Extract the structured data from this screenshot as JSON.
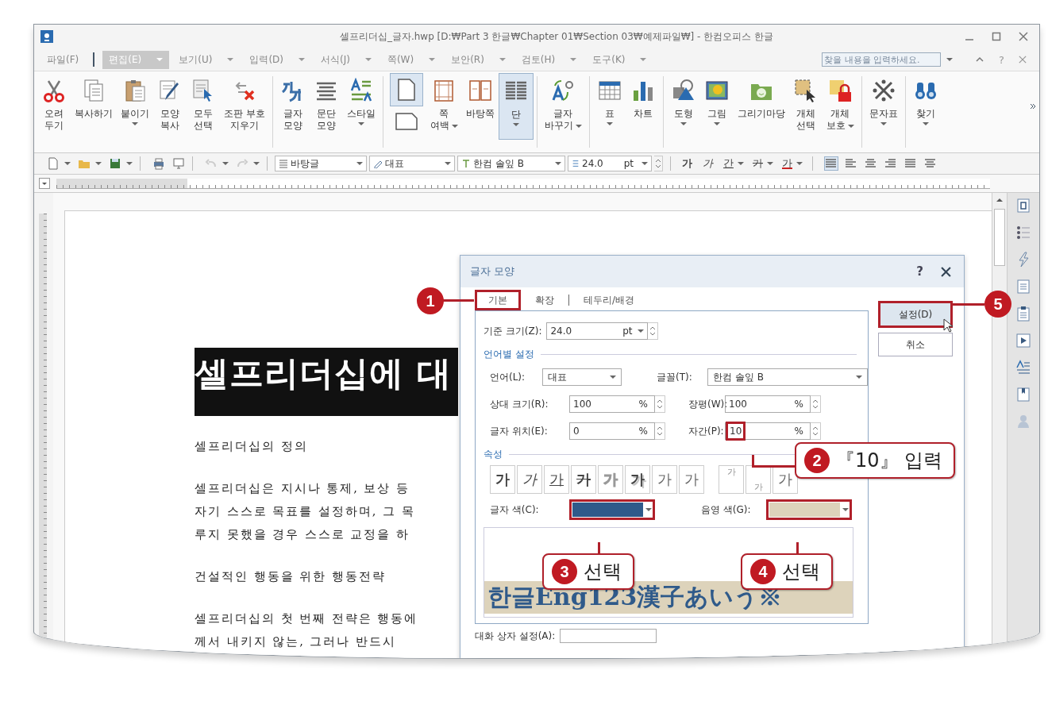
{
  "window": {
    "title": "셀프리더십_글자.hwp [D:₩Part 3 한글₩Chapter 01₩Section 03₩예제파일₩] - 한컴오피스 한글"
  },
  "menu": [
    {
      "label": "파일(F)",
      "selected": false,
      "dropdown": false
    },
    {
      "label": "편집(E)",
      "selected": true,
      "dropdown": true
    },
    {
      "label": "보기(U)",
      "selected": false,
      "dropdown": true
    },
    {
      "label": "입력(D)",
      "selected": false,
      "dropdown": true
    },
    {
      "label": "서식(J)",
      "selected": false,
      "dropdown": true
    },
    {
      "label": "쪽(W)",
      "selected": false,
      "dropdown": true
    },
    {
      "label": "보안(R)",
      "selected": false,
      "dropdown": true
    },
    {
      "label": "검토(H)",
      "selected": false,
      "dropdown": true
    },
    {
      "label": "도구(K)",
      "selected": false,
      "dropdown": true
    }
  ],
  "search": {
    "placeholder": "찾을 내용을 입력하세요."
  },
  "help": "?",
  "ribbon": [
    [
      {
        "lines": [
          "오려",
          "두기"
        ],
        "dropdown": false,
        "selected": false
      },
      {
        "lines": [
          "복사하기"
        ],
        "dropdown": false,
        "selected": false
      },
      {
        "lines": [
          "붙이기"
        ],
        "dropdown": true,
        "selected": false
      },
      {
        "lines": [
          "모양",
          "복사"
        ],
        "dropdown": false,
        "selected": false
      },
      {
        "lines": [
          "모두",
          "선택"
        ],
        "dropdown": false,
        "selected": false
      },
      {
        "lines": [
          "조판 부호",
          "지우기"
        ],
        "dropdown": false,
        "selected": false
      }
    ],
    [
      {
        "lines": [
          "글자",
          "모양"
        ],
        "dropdown": false,
        "selected": false
      },
      {
        "lines": [
          "문단",
          "모양"
        ],
        "dropdown": false,
        "selected": false
      },
      {
        "lines": [
          "스타일"
        ],
        "dropdown": true,
        "selected": false
      }
    ],
    [
      {
        "kind": "stacked",
        "selected": true
      },
      {
        "lines": [
          "쪽",
          "여백"
        ],
        "dropdown": true,
        "selected": false
      },
      {
        "lines": [
          "바탕쪽"
        ],
        "dropdown": false,
        "selected": false
      },
      {
        "lines": [
          "단"
        ],
        "dropdown": true,
        "selected": true
      }
    ],
    [
      {
        "lines": [
          "글자",
          "바꾸기"
        ],
        "dropdown": true,
        "selected": false
      }
    ],
    [
      {
        "lines": [
          "표"
        ],
        "dropdown": true,
        "selected": false
      },
      {
        "lines": [
          "차트"
        ],
        "dropdown": false,
        "selected": false
      }
    ],
    [
      {
        "lines": [
          "도형"
        ],
        "dropdown": true,
        "selected": false
      },
      {
        "lines": [
          "그림"
        ],
        "dropdown": true,
        "selected": false
      },
      {
        "lines": [
          "그리기마당"
        ],
        "dropdown": false,
        "selected": false
      },
      {
        "lines": [
          "개체",
          "선택"
        ],
        "dropdown": false,
        "selected": false
      },
      {
        "lines": [
          "개체",
          "보호"
        ],
        "dropdown": true,
        "selected": false
      }
    ],
    [
      {
        "lines": [
          "문자표"
        ],
        "dropdown": true,
        "selected": false
      }
    ],
    [
      {
        "lines": [
          "찾기"
        ],
        "dropdown": true,
        "selected": false
      }
    ]
  ],
  "toolbar": {
    "style": "바탕글",
    "shape": "대표",
    "font": "한컴 솔잎 B",
    "size": "24.0",
    "unit": "pt",
    "format_buttons": [
      {
        "label": "가",
        "dropdown": false
      },
      {
        "label": "가",
        "dropdown": false
      },
      {
        "label": "간",
        "dropdown": true
      },
      {
        "label": "가",
        "dropdown": true
      },
      {
        "label": "가",
        "dropdown": true
      }
    ]
  },
  "document": {
    "heading": "셀프리더십에 대",
    "paragraphs": [
      [
        "셀프리더십의 정의"
      ],
      [
        "셀프리더십은 지시나 통제, 보상 등",
        "자기 스스로 목표를 설정하며, 그 목",
        "루지 못했을 경우 스스로 교정을 하"
      ],
      [
        "건설적인 행동을 위한 행동전략"
      ],
      [
        "셀프리더십의 첫 번째 전략은 행동에",
        "께서 내키지 않는, 그러나 반드시"
      ]
    ]
  },
  "dialog": {
    "title": "글자 모양",
    "help": "?",
    "tabs": [
      {
        "label": "기본",
        "selected": true
      },
      {
        "label": "확장",
        "selected": false
      },
      {
        "label": "테두리/배경",
        "selected": false
      }
    ],
    "base_size": {
      "label": "기준 크기(Z):",
      "value": "24.0",
      "unit": "pt"
    },
    "language_group": "언어별 설정",
    "language": {
      "label": "언어(L):",
      "value": "대표"
    },
    "font": {
      "label": "글꼴(T):",
      "value": "한컴 솔잎 B"
    },
    "fields": [
      {
        "label": "상대 크기(R):",
        "value": "100",
        "unit": "%"
      },
      {
        "label": "장평(W):",
        "value": "100",
        "unit": "%"
      },
      {
        "label": "글자 위치(E):",
        "value": "0",
        "unit": "%"
      },
      {
        "label": "자간(P):",
        "value": "10",
        "unit": "%"
      }
    ],
    "attribute_group": "속성",
    "attributes": [
      "가",
      "가",
      "가",
      "가",
      "가",
      "가",
      "가",
      "가",
      "가",
      "가",
      "가"
    ],
    "text_color": {
      "label": "글자 색(C):",
      "color": "#2f5a8a"
    },
    "shade_color": {
      "label": "음영 색(G):",
      "color": "#ddd3bb"
    },
    "preview": "한글Eng123漢子あいう※",
    "footer_label": "대화 상자 설정(A):",
    "buttons": [
      "설정(D)",
      "취소"
    ]
  },
  "callouts": [
    {
      "number": "1"
    },
    {
      "number": "2",
      "text": "『10』 입력"
    },
    {
      "number": "3",
      "text": "선택"
    },
    {
      "number": "4",
      "text": "선택"
    },
    {
      "number": "5"
    }
  ]
}
